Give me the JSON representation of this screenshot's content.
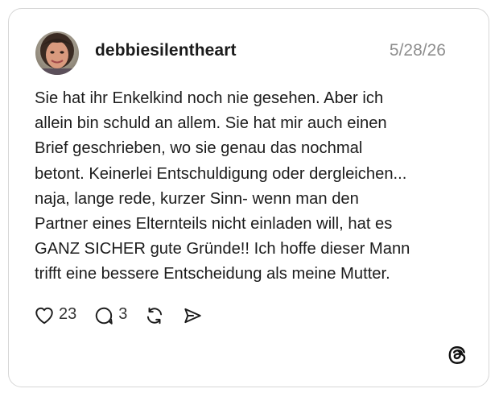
{
  "post": {
    "username": "debbiesilentheart",
    "date": "5/28/26",
    "text": "Sie hat ihr Enkelkind noch nie gesehen. Aber ich\nallein bin schuld an allem. Sie hat mir auch einen\nBrief geschrieben, wo sie genau das nochmal\nbetont. Keinerlei Entschuldigung oder dergleichen...\nnaja, lange rede, kurzer Sinn- wenn man den\nPartner eines Elternteils nicht einladen will, hat es\nGANZ SICHER gute Gründe!! Ich hoffe dieser Mann\ntrifft eine bessere Entscheidung als meine Mutter."
  },
  "actions": {
    "likes": "23",
    "replies": "3",
    "like_icon": "heart-icon",
    "reply_icon": "comment-icon",
    "repost_icon": "repost-icon",
    "share_icon": "send-icon"
  },
  "brand": {
    "logo_icon": "threads-logo-icon"
  },
  "colors": {
    "card_border": "#d6d6d6",
    "text": "#1c1c1c",
    "date": "#8e8e8e"
  }
}
